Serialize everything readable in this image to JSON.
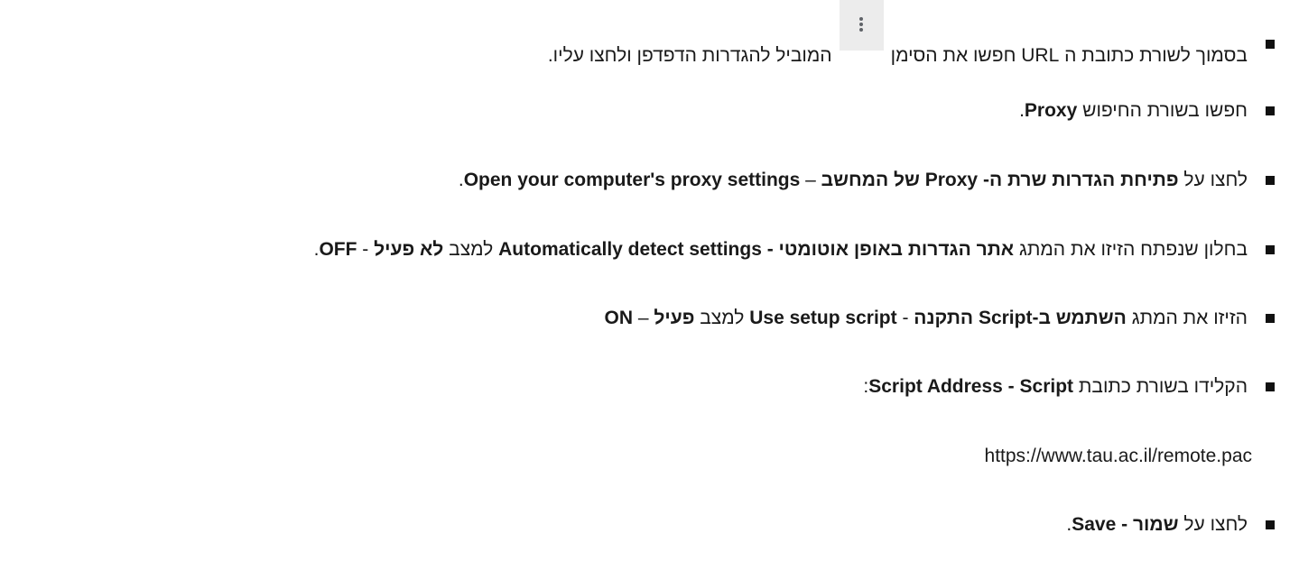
{
  "steps": [
    {
      "pre": "בסמוך לשורת כתובת ה URL חפשו את הסימן",
      "post": "המוביל להגדרות הדפדפן ולחצו עליו."
    },
    {
      "pre": "חפשו בשורת החיפוש",
      "bold": "Proxy",
      "post": "."
    },
    {
      "pre": "לחצו על",
      "bold1": "פתיחת הגדרות שרת ה- Proxy של המחשב",
      "mid": " – ",
      "bold2": "Open your computer's proxy settings",
      "post": "."
    },
    {
      "pre": "בחלון שנפתח הזיזו את המתג",
      "bold1": "אתר הגדרות באופן אוטומטי - Automatically detect settings",
      "mid": "למצב",
      "bold2": "לא פעיל",
      "sep": " - ",
      "bold3": "OFF",
      "post": "."
    },
    {
      "pre": "הזיזו את המתג",
      "bold1": "השתמש ב-Script התקנה",
      "sep": " - ",
      "bold2": "Use setup script",
      "mid": "למצב",
      "bold3": "פעיל",
      "sep2": " – ",
      "bold4": "ON"
    },
    {
      "pre": "הקלידו בשורת כתובת",
      "bold": "Script Address - Script",
      "post": ":"
    },
    {
      "pre": "לחצו על",
      "bold": "שמור - Save",
      "post": "."
    }
  ],
  "script_url": "https://www.tau.ac.il/remote.pac"
}
